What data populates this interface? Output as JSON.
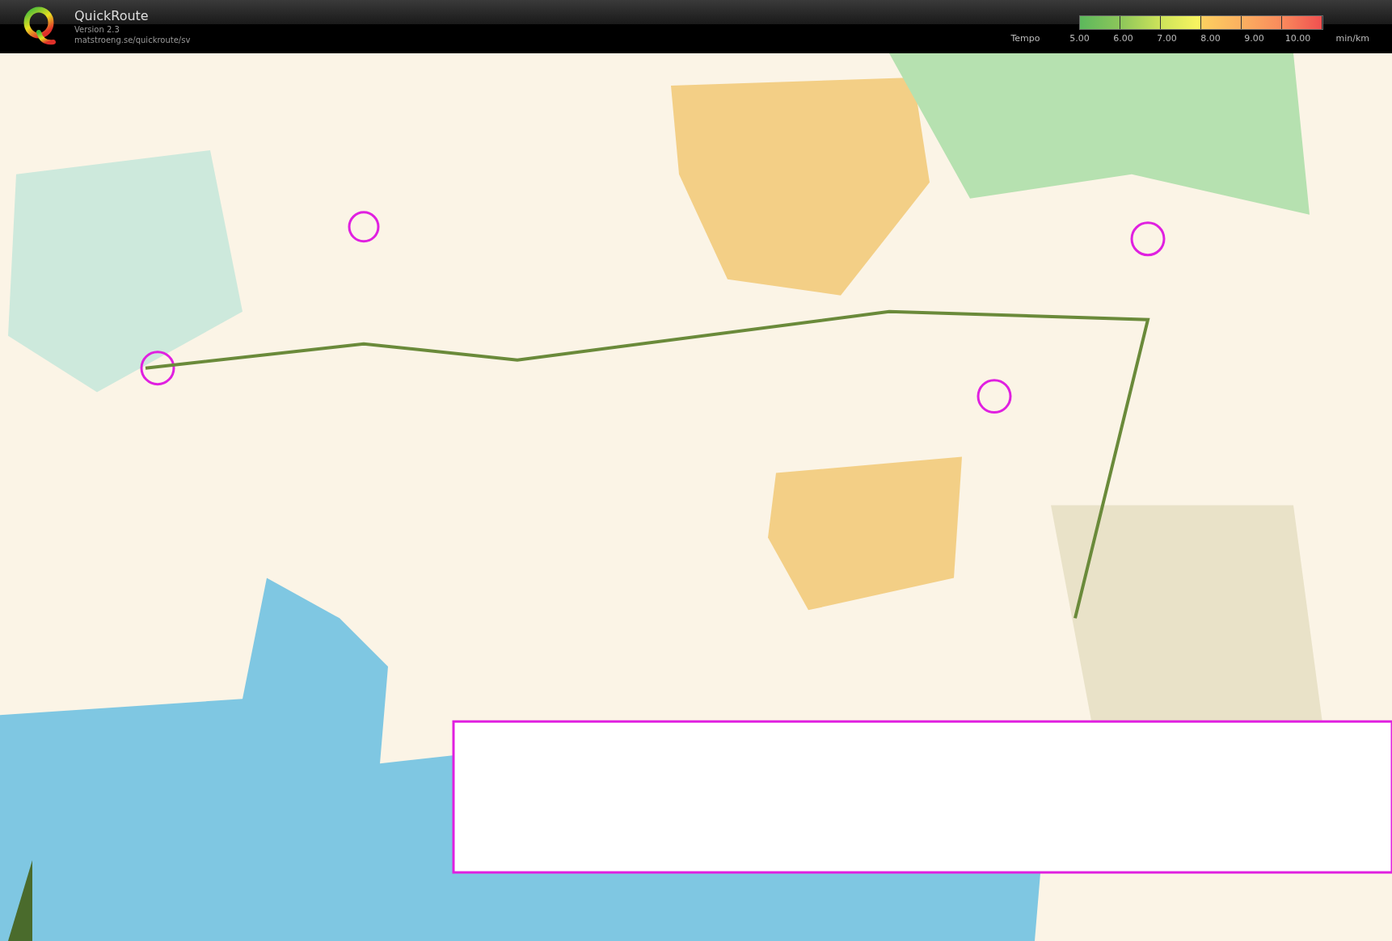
{
  "app": {
    "title": "QuickRoute",
    "version": "Version 2.3",
    "url": "matstroeng.se/quickroute/sv"
  },
  "legend": {
    "label": "Tempo",
    "ticks": [
      "5.00",
      "6.00",
      "7.00",
      "8.00",
      "9.00",
      "10.00"
    ],
    "unit": "min/km"
  }
}
